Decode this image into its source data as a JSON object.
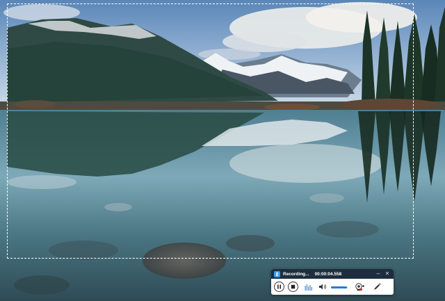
{
  "recorder": {
    "status": "Recording...",
    "elapsed": "00:00:04.558",
    "minimize_symbol": "–",
    "close_symbol": "✕",
    "volume_level": 0.95,
    "colors": {
      "header": "#1e2e3e",
      "accent": "#1f7fd6",
      "logo": "#3a9be8"
    },
    "icons": [
      "recorder-logo-icon",
      "pause-icon",
      "stop-icon",
      "audio-levels-icon",
      "speaker-icon",
      "webcam-icon",
      "pen-icon"
    ]
  }
}
